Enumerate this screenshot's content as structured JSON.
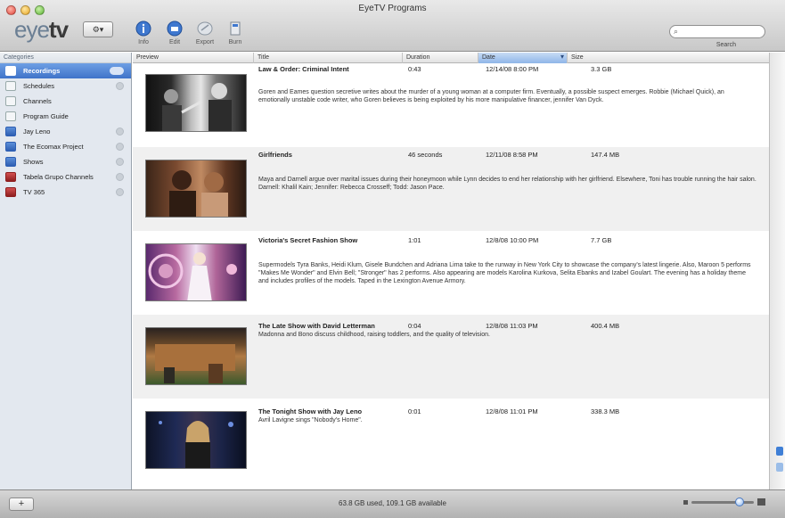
{
  "window": {
    "title": "EyeTV Programs"
  },
  "toolbar": {
    "logo": {
      "eye": "eye",
      "tv": "tv"
    },
    "action_label": "⚙▾",
    "tools": [
      {
        "name": "info-tool",
        "label": "Info",
        "icon": "info-icon"
      },
      {
        "name": "edit-tool",
        "label": "Edit",
        "icon": "edit-icon"
      },
      {
        "name": "export-tool",
        "label": "Export",
        "icon": "export-icon"
      },
      {
        "name": "burn-tool",
        "label": "Burn",
        "icon": "burn-icon"
      }
    ],
    "search": {
      "placeholder": "",
      "label": "Search"
    }
  },
  "sidebar": {
    "header": "Categories",
    "items": [
      {
        "label": "Recordings",
        "icon": "recordings-icon",
        "selected": true
      },
      {
        "label": "Schedules",
        "icon": "schedules-icon"
      },
      {
        "label": "Channels",
        "icon": "channels-icon"
      },
      {
        "label": "Program Guide",
        "icon": "guide-icon"
      },
      {
        "label": "Jay Leno",
        "icon": "playlist-icon"
      },
      {
        "label": "The Ecomax Project",
        "icon": "playlist-icon"
      },
      {
        "label": "Shows",
        "icon": "playlist-icon"
      },
      {
        "label": "Tabela Grupo Channels",
        "icon": "smart-playlist-icon"
      },
      {
        "label": "TV 365",
        "icon": "smart-playlist-icon"
      }
    ]
  },
  "table": {
    "columns": [
      "Preview",
      "Title",
      "Duration",
      "Date",
      "Size"
    ],
    "sorted_column": "Date",
    "rows": [
      {
        "title": "Law & Order: Criminal Intent",
        "duration": "0:43",
        "date": "12/14/08 8:00 PM",
        "size": "3.3 GB",
        "description": "Goren and Eames question secretive writes about the murder of a young woman at a computer firm. Eventually, a possible suspect emerges. Robbie (Michael Quick), an emotionally unstable code writer, who Goren believes is being exploited by his more manipulative financer, jennifer Van Dyck."
      },
      {
        "title": "Girlfriends",
        "duration": "46 seconds",
        "date": "12/11/08 8:58 PM",
        "size": "147.4 MB",
        "description": "Maya and Darnell argue over marital issues during their honeymoon while Lynn decides to end her relationship with her girlfriend. Elsewhere, Toni has trouble running the hair salon. Darnell: Khalil Kain; Jennifer: Rebecca Crosseff; Todd: Jason Pace."
      },
      {
        "title": "Victoria's Secret Fashion Show",
        "duration": "1:01",
        "date": "12/8/08 10:00 PM",
        "size": "7.7 GB",
        "description": "Supermodels Tyra Banks, Heidi Klum, Gisele Bundchen and Adriana Lima take to the runway in New York City to showcase the company's latest lingerie. Also, Maroon 5 performs \"Makes Me Wonder\" and Elvin Bell; \"Stronger\" has 2 performs. Also appearing are models Karolina Kurkova, Selita Ebanks and Izabel Goulart. The evening has a holiday theme and includes profiles of the models. Taped in the Lexington Avenue Armory."
      },
      {
        "title": "The Late Show with David Letterman",
        "duration": "0:04",
        "date": "12/8/08 11:03 PM",
        "size": "400.4 MB",
        "description": "Madonna and Bono discuss childhood, raising toddlers, and the quality of television."
      },
      {
        "title": "The Tonight Show with Jay Leno",
        "duration": "0:01",
        "date": "12/8/08 11:01 PM",
        "size": "338.3 MB",
        "description": "Avril Lavigne sings \"Nobody's Home\"."
      }
    ]
  },
  "status": {
    "text": "63.8 GB used, 109.1 GB available"
  },
  "zoom": {
    "level": 0.82
  }
}
